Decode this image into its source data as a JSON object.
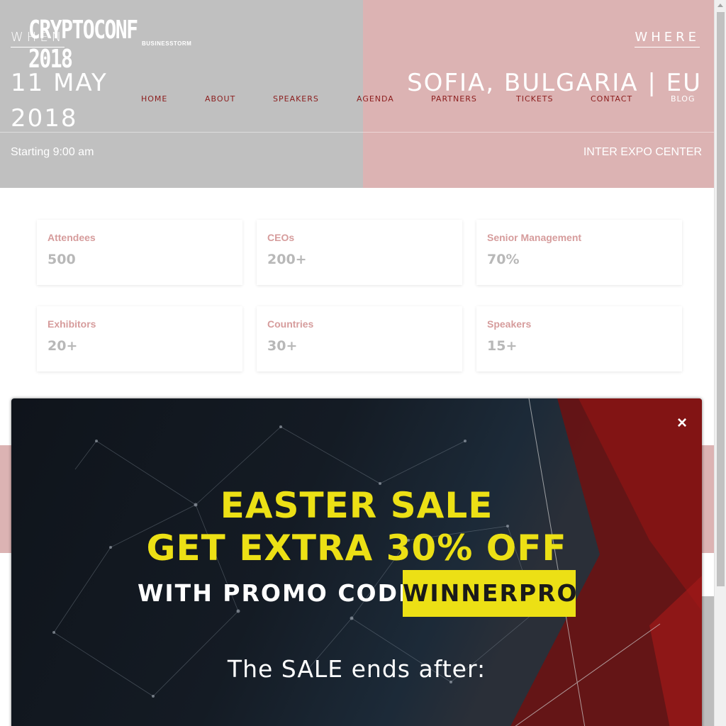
{
  "header": {
    "logo_main": "CRYPTOCONF 2018",
    "logo_sub": "BUSINESSTORM",
    "when_label": "WHEN",
    "where_label": "WHERE",
    "date": "11 MAY 2018",
    "location": "SOFIA, BULGARIA | EU",
    "time": "Starting 9:00 am",
    "venue": "INTER EXPO CENTER"
  },
  "nav": {
    "items": [
      {
        "label": "HOME"
      },
      {
        "label": "ABOUT"
      },
      {
        "label": "SPEAKERS"
      },
      {
        "label": "AGENDA"
      },
      {
        "label": "PARTNERS"
      },
      {
        "label": "TICKETS"
      },
      {
        "label": "CONTACT"
      },
      {
        "label": "BLOG"
      }
    ]
  },
  "stats": [
    {
      "label": "Attendees",
      "value": "500"
    },
    {
      "label": "CEOs",
      "value": "200+"
    },
    {
      "label": "Senior Management",
      "value": "70%"
    },
    {
      "label": "Exhibitors",
      "value": "20+"
    },
    {
      "label": "Countries",
      "value": "30+"
    },
    {
      "label": "Speakers",
      "value": "15+"
    }
  ],
  "modal": {
    "close_symbol": "×",
    "headline_1": "EASTER SALE",
    "headline_2": "GET EXTRA 30% OFF",
    "promo_label": "WITH PROMO CODE:",
    "promo_code": "WINNERPRO",
    "sale_ends": "The SALE ends after:"
  },
  "colors": {
    "hero_left": "#c0c0c0",
    "hero_right": "#dcb3b3",
    "nav_text": "#8b1d1d",
    "accent_yellow": "#ece015",
    "modal_dark": "#0f141b",
    "modal_red": "#8a1414"
  }
}
